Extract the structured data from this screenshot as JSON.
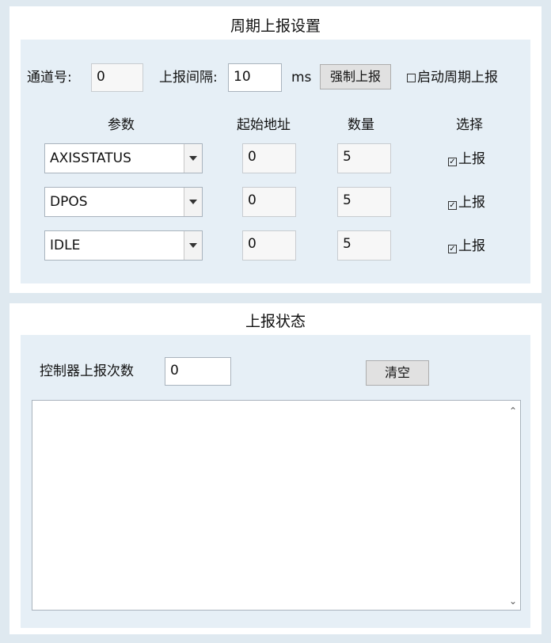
{
  "periodic": {
    "title": "周期上报设置",
    "channel_label": "通道号:",
    "channel_value": "0",
    "interval_label": "上报间隔:",
    "interval_value": "10",
    "interval_unit": "ms",
    "force_button": "强制上报",
    "enable_label": "启动周期上报",
    "enable_checked": false,
    "headers": {
      "param": "参数",
      "address": "起始地址",
      "count": "数量",
      "select": "选择"
    },
    "rows": [
      {
        "param": "AXISSTATUS",
        "address": "0",
        "count": "5",
        "select_label": "上报",
        "checked": true
      },
      {
        "param": "DPOS",
        "address": "0",
        "count": "5",
        "select_label": "上报",
        "checked": true
      },
      {
        "param": "IDLE",
        "address": "0",
        "count": "5",
        "select_label": "上报",
        "checked": true
      }
    ]
  },
  "status": {
    "title": "上报状态",
    "count_label": "控制器上报次数",
    "count_value": "0",
    "clear_button": "清空",
    "log_text": ""
  },
  "icons": {
    "combo_arrow": "chevron-down-icon",
    "scroll_up": "scroll-up-icon",
    "scroll_down": "scroll-down-icon",
    "checkbox": "checkbox-icon"
  }
}
